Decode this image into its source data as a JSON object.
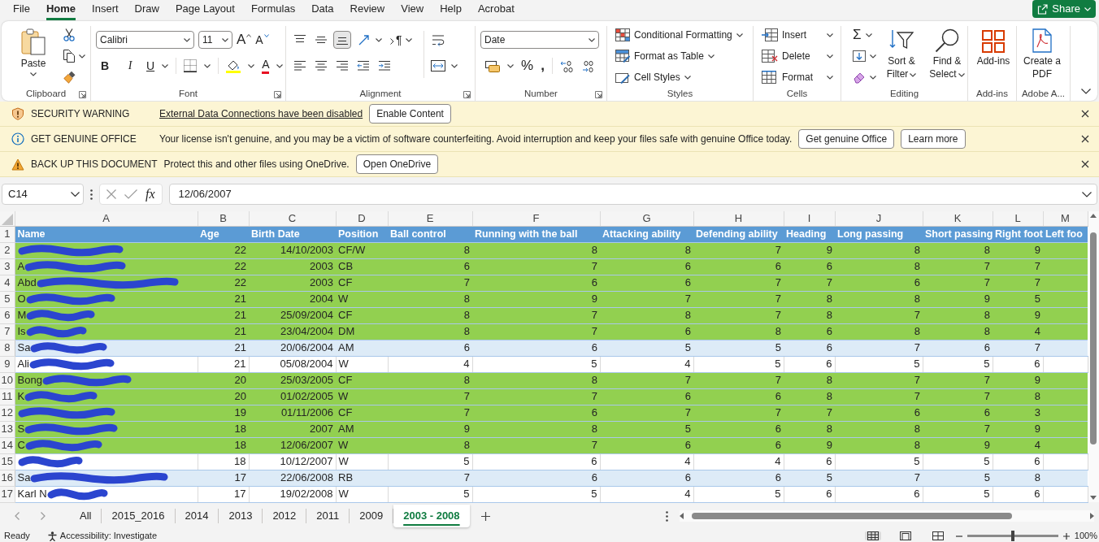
{
  "menu_tabs": [
    {
      "label": "File",
      "selected": false
    },
    {
      "label": "Home",
      "selected": true
    },
    {
      "label": "Insert",
      "selected": false
    },
    {
      "label": "Draw",
      "selected": false
    },
    {
      "label": "Page Layout",
      "selected": false
    },
    {
      "label": "Formulas",
      "selected": false
    },
    {
      "label": "Data",
      "selected": false
    },
    {
      "label": "Review",
      "selected": false
    },
    {
      "label": "View",
      "selected": false
    },
    {
      "label": "Help",
      "selected": false
    },
    {
      "label": "Acrobat",
      "selected": false
    }
  ],
  "share_button": {
    "label": "Share"
  },
  "ribbon": {
    "groups": [
      {
        "kind": "clipboard",
        "label": "Clipboard",
        "launcher": true,
        "paste_label": "Paste"
      },
      {
        "kind": "font",
        "label": "Font",
        "launcher": true,
        "font_name": "Calibri",
        "font_size": "11",
        "grow_label": "A",
        "shrink_label": "A",
        "bold_label": "B",
        "italic_label": "I",
        "underline_label": "U",
        "font_color_label": "A"
      },
      {
        "kind": "alignment",
        "label": "Alignment",
        "launcher": true,
        "vertical_align": [
          {
            "kind": "top",
            "selected": false
          },
          {
            "kind": "middle",
            "selected": false
          },
          {
            "kind": "bottom",
            "selected": true
          }
        ],
        "direction_label": "¶"
      },
      {
        "kind": "number",
        "label": "Number",
        "launcher": true,
        "format": "Date",
        "percent_label": "%",
        "comma_label": ","
      },
      {
        "kind": "styles",
        "label": "Styles",
        "buttons": [
          {
            "kind": "conditional",
            "label": "Conditional Formatting"
          },
          {
            "kind": "table",
            "label": "Format as Table"
          },
          {
            "kind": "cell",
            "label": "Cell Styles"
          }
        ]
      },
      {
        "kind": "cells",
        "label": "Cells",
        "buttons": [
          {
            "kind": "insert",
            "label": "Insert"
          },
          {
            "kind": "delete",
            "label": "Delete"
          },
          {
            "kind": "format",
            "label": "Format"
          }
        ]
      },
      {
        "kind": "editing",
        "label": "Editing",
        "autosum_label": "Σ",
        "large_buttons": [
          {
            "kind": "sort",
            "label": "Sort & Filter"
          },
          {
            "kind": "find",
            "label": "Find & Select"
          }
        ]
      },
      {
        "kind": "addins",
        "label": "Add-ins",
        "button_label": "Add-ins"
      },
      {
        "kind": "adobe",
        "label": "Adobe A...",
        "button_label": "Create a PDF"
      }
    ]
  },
  "message_bars": [
    {
      "kind": "shield",
      "title": "SECURITY WARNING",
      "link": "External Data Connections have been disabled",
      "buttons": [
        "Enable Content"
      ]
    },
    {
      "kind": "info",
      "title": "GET GENUINE OFFICE",
      "text": "Your license isn't genuine, and you may be a victim of software counterfeiting. Avoid interruption and keep your files safe with genuine Office today.",
      "buttons": [
        "Get genuine Office",
        "Learn more"
      ]
    },
    {
      "kind": "warning",
      "title": "BACK UP THIS DOCUMENT",
      "text": "Protect this and other files using OneDrive.",
      "buttons": [
        "Open OneDrive"
      ]
    }
  ],
  "formula_bar": {
    "name_box": "C14",
    "function_label": "fx",
    "formula": "12/06/2007"
  },
  "sheet": {
    "column_letters": [
      "A",
      "B",
      "C",
      "D",
      "E",
      "F",
      "G",
      "H",
      "I",
      "J",
      "K",
      "L",
      "M"
    ],
    "rows": [
      {
        "number": "1",
        "kind": "header",
        "color": "#5b9bd5",
        "cells": [
          "Name",
          "Age",
          "Birth Date",
          "Position",
          "Ball control",
          "Running with the ball",
          "Attacking ability",
          "Defending ability",
          "Heading",
          "Long passing",
          "Short passing",
          "Right foot",
          "Left foo"
        ]
      },
      {
        "number": "2",
        "kind": "data",
        "color": "#92d050",
        "redacted": true,
        "cells": [
          "",
          "22",
          "14/10/2003",
          "CF/W",
          "8",
          "8",
          "8",
          "7",
          "9",
          "8",
          "8",
          "9"
        ]
      },
      {
        "number": "3",
        "kind": "data",
        "color": "#92d050",
        "redacted": true,
        "cells": [
          "A",
          "22",
          "2003",
          "CB",
          "6",
          "7",
          "6",
          "6",
          "6",
          "8",
          "7",
          "7"
        ]
      },
      {
        "number": "4",
        "kind": "data",
        "color": "#92d050",
        "redacted": true,
        "cells": [
          "Abd",
          "22",
          "2003",
          "CF",
          "7",
          "6",
          "6",
          "7",
          "7",
          "6",
          "7",
          "7"
        ]
      },
      {
        "number": "5",
        "kind": "data",
        "color": "#92d050",
        "redacted": true,
        "cells": [
          "O",
          "21",
          "2004",
          "W",
          "8",
          "9",
          "7",
          "7",
          "8",
          "8",
          "9",
          "5"
        ]
      },
      {
        "number": "6",
        "kind": "data",
        "color": "#92d050",
        "redacted": true,
        "cells": [
          "M",
          "21",
          "25/09/2004",
          "CF",
          "8",
          "7",
          "8",
          "7",
          "8",
          "7",
          "8",
          "9"
        ]
      },
      {
        "number": "7",
        "kind": "data",
        "color": "#92d050",
        "redacted": true,
        "cells": [
          "Is",
          "21",
          "23/04/2004",
          "DM",
          "8",
          "7",
          "6",
          "8",
          "6",
          "8",
          "8",
          "4"
        ]
      },
      {
        "number": "8",
        "kind": "data",
        "color": "#ddebf7",
        "redacted": true,
        "cells": [
          "Sa",
          "21",
          "20/06/2004",
          "AM",
          "6",
          "6",
          "5",
          "5",
          "6",
          "7",
          "6",
          "7"
        ]
      },
      {
        "number": "9",
        "kind": "data",
        "color": "#ffffff",
        "redacted": true,
        "cells": [
          "Ali",
          "21",
          "05/08/2004",
          "W",
          "4",
          "5",
          "4",
          "5",
          "6",
          "5",
          "5",
          "6"
        ]
      },
      {
        "number": "10",
        "kind": "data",
        "color": "#92d050",
        "redacted": true,
        "cells": [
          "Bong",
          "20",
          "25/03/2005",
          "CF",
          "8",
          "8",
          "7",
          "7",
          "8",
          "7",
          "7",
          "9"
        ]
      },
      {
        "number": "11",
        "kind": "data",
        "color": "#92d050",
        "redacted": true,
        "cells": [
          "K",
          "20",
          "01/02/2005",
          "W",
          "7",
          "7",
          "6",
          "6",
          "8",
          "7",
          "7",
          "8"
        ]
      },
      {
        "number": "12",
        "kind": "data",
        "color": "#92d050",
        "redacted": true,
        "cells": [
          "",
          "19",
          "01/11/2006",
          "CF",
          "7",
          "6",
          "7",
          "7",
          "7",
          "6",
          "6",
          "3"
        ]
      },
      {
        "number": "13",
        "kind": "data",
        "color": "#92d050",
        "redacted": true,
        "cells": [
          "S",
          "18",
          "2007",
          "AM",
          "9",
          "8",
          "5",
          "6",
          "8",
          "8",
          "7",
          "9"
        ]
      },
      {
        "number": "14",
        "kind": "data",
        "color": "#92d050",
        "redacted": true,
        "cells": [
          "C",
          "18",
          "12/06/2007",
          "W",
          "8",
          "7",
          "6",
          "6",
          "9",
          "8",
          "9",
          "4"
        ]
      },
      {
        "number": "15",
        "kind": "data",
        "color": "#ffffff",
        "redacted": true,
        "cells": [
          "",
          "18",
          "10/12/2007",
          "W",
          "5",
          "6",
          "4",
          "4",
          "6",
          "5",
          "5",
          "6"
        ]
      },
      {
        "number": "16",
        "kind": "data",
        "color": "#ddebf7",
        "redacted": true,
        "cells": [
          "Sa",
          "17",
          "22/06/2008",
          "RB",
          "7",
          "6",
          "6",
          "6",
          "5",
          "7",
          "5",
          "8"
        ]
      },
      {
        "number": "17",
        "kind": "data",
        "color": "#ffffff",
        "redacted": true,
        "cells": [
          "Karl N",
          "17",
          "19/02/2008",
          "W",
          "5",
          "5",
          "4",
          "5",
          "6",
          "6",
          "5",
          "6"
        ]
      }
    ]
  },
  "sheet_tabs": [
    {
      "label": "All",
      "selected": false
    },
    {
      "label": "2015_2016",
      "selected": false
    },
    {
      "label": "2014",
      "selected": false
    },
    {
      "label": "2013",
      "selected": false
    },
    {
      "label": "2012",
      "selected": false
    },
    {
      "label": "2011",
      "selected": false
    },
    {
      "label": "2009",
      "selected": false
    },
    {
      "label": "2003 - 2008",
      "selected": true
    }
  ],
  "status_bar": {
    "status": "Ready",
    "accessibility": "Accessibility: Investigate",
    "views": [
      {
        "kind": "normal",
        "selected": true
      },
      {
        "kind": "page_layout",
        "selected": false
      },
      {
        "kind": "page_break",
        "selected": false
      }
    ],
    "zoom": {
      "level": 0.5,
      "reading": "100%"
    }
  }
}
